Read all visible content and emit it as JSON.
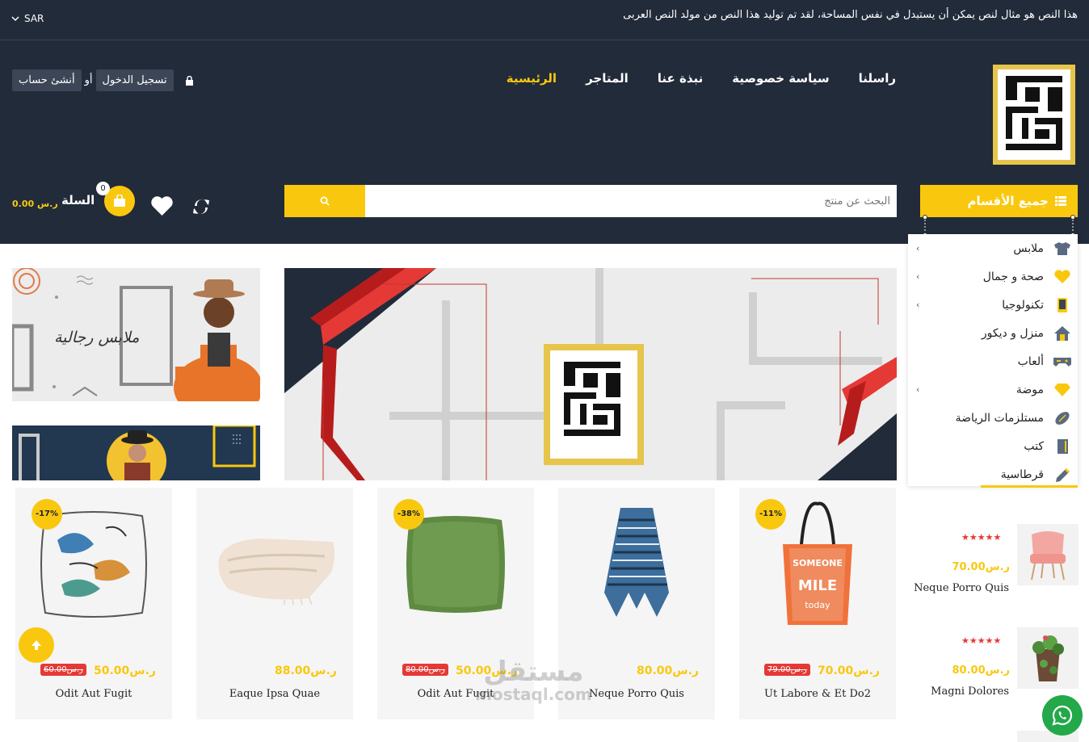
{
  "topbar": {
    "announcement": "هذا النص هو مثال لنص يمكن أن يستبدل في نفس المساحة، لقد تم توليد هذا النص من مولد النص العربى",
    "currency": "SAR"
  },
  "nav": {
    "items": [
      "الرئيسية",
      "المتاجر",
      "نبذة عنا",
      "سياسة خصوصية",
      "راسلنا"
    ],
    "active_index": 0
  },
  "auth": {
    "login": "تسجيل الدخول",
    "or": "أو",
    "register": "أنشئ حساب"
  },
  "header": {
    "all_categories": "جميع الأقسام",
    "search_placeholder": "البحث عن منتج",
    "cart_label": "السلة",
    "cart_count": "0",
    "cart_total": "0.00 ر.س"
  },
  "categories": [
    {
      "label": "ملابس",
      "icon": "shirt-icon",
      "has_sub": true
    },
    {
      "label": "صحة و جمال",
      "icon": "heart-icon",
      "has_sub": true
    },
    {
      "label": "تكنولوجيا",
      "icon": "tablet-icon",
      "has_sub": true
    },
    {
      "label": "منزل و ديكور",
      "icon": "home-icon",
      "has_sub": false
    },
    {
      "label": "ألعاب",
      "icon": "gamepad-icon",
      "has_sub": false
    },
    {
      "label": "موضة",
      "icon": "diamond-icon",
      "has_sub": true
    },
    {
      "label": "مستلزمات الرياضة",
      "icon": "football-icon",
      "has_sub": false
    },
    {
      "label": "كتب",
      "icon": "book-icon",
      "has_sub": false
    },
    {
      "label": "قرطاسية",
      "icon": "pencil-icon",
      "has_sub": false
    }
  ],
  "banners": {
    "men_clothing": "ملابس رجالية"
  },
  "products": [
    {
      "name": "Ut Labore & Et Do2",
      "price": "70.00ر.س",
      "old_price": "79.00ر.س",
      "badge": "-11%",
      "image": "tote-bag"
    },
    {
      "name": "Neque Porro Quis",
      "price": "80.00ر.س",
      "old_price": "",
      "badge": "",
      "image": "scarf"
    },
    {
      "name": "Odit Aut Fugit",
      "price": "50.00ر.س",
      "old_price": "80.00ر.س",
      "badge": "-38%",
      "image": "green-pillow"
    },
    {
      "name": "Eaque Ipsa Quae",
      "price": "88.00ر.س",
      "old_price": "",
      "badge": "",
      "image": "blanket"
    },
    {
      "name": "Odit Aut Fugit",
      "price": "50.00ر.س",
      "old_price": "60.00ر.س",
      "badge": "-17%",
      "image": "bird-pillow"
    }
  ],
  "side_products": [
    {
      "name": "Neque Porro Quis",
      "price": "70.00ر.س",
      "stars": "★★★★★",
      "image": "pink-chair"
    },
    {
      "name": "Magni Dolores",
      "price": "80.00ر.س",
      "stars": "★★★★★",
      "image": "plant-pot"
    }
  ],
  "watermark": {
    "ar": "مستقل",
    "en": "mostaql.com"
  },
  "colors": {
    "header_bg": "#222b3a",
    "accent": "#f9c80e",
    "sale": "#e53935",
    "whatsapp": "#23a84a"
  }
}
